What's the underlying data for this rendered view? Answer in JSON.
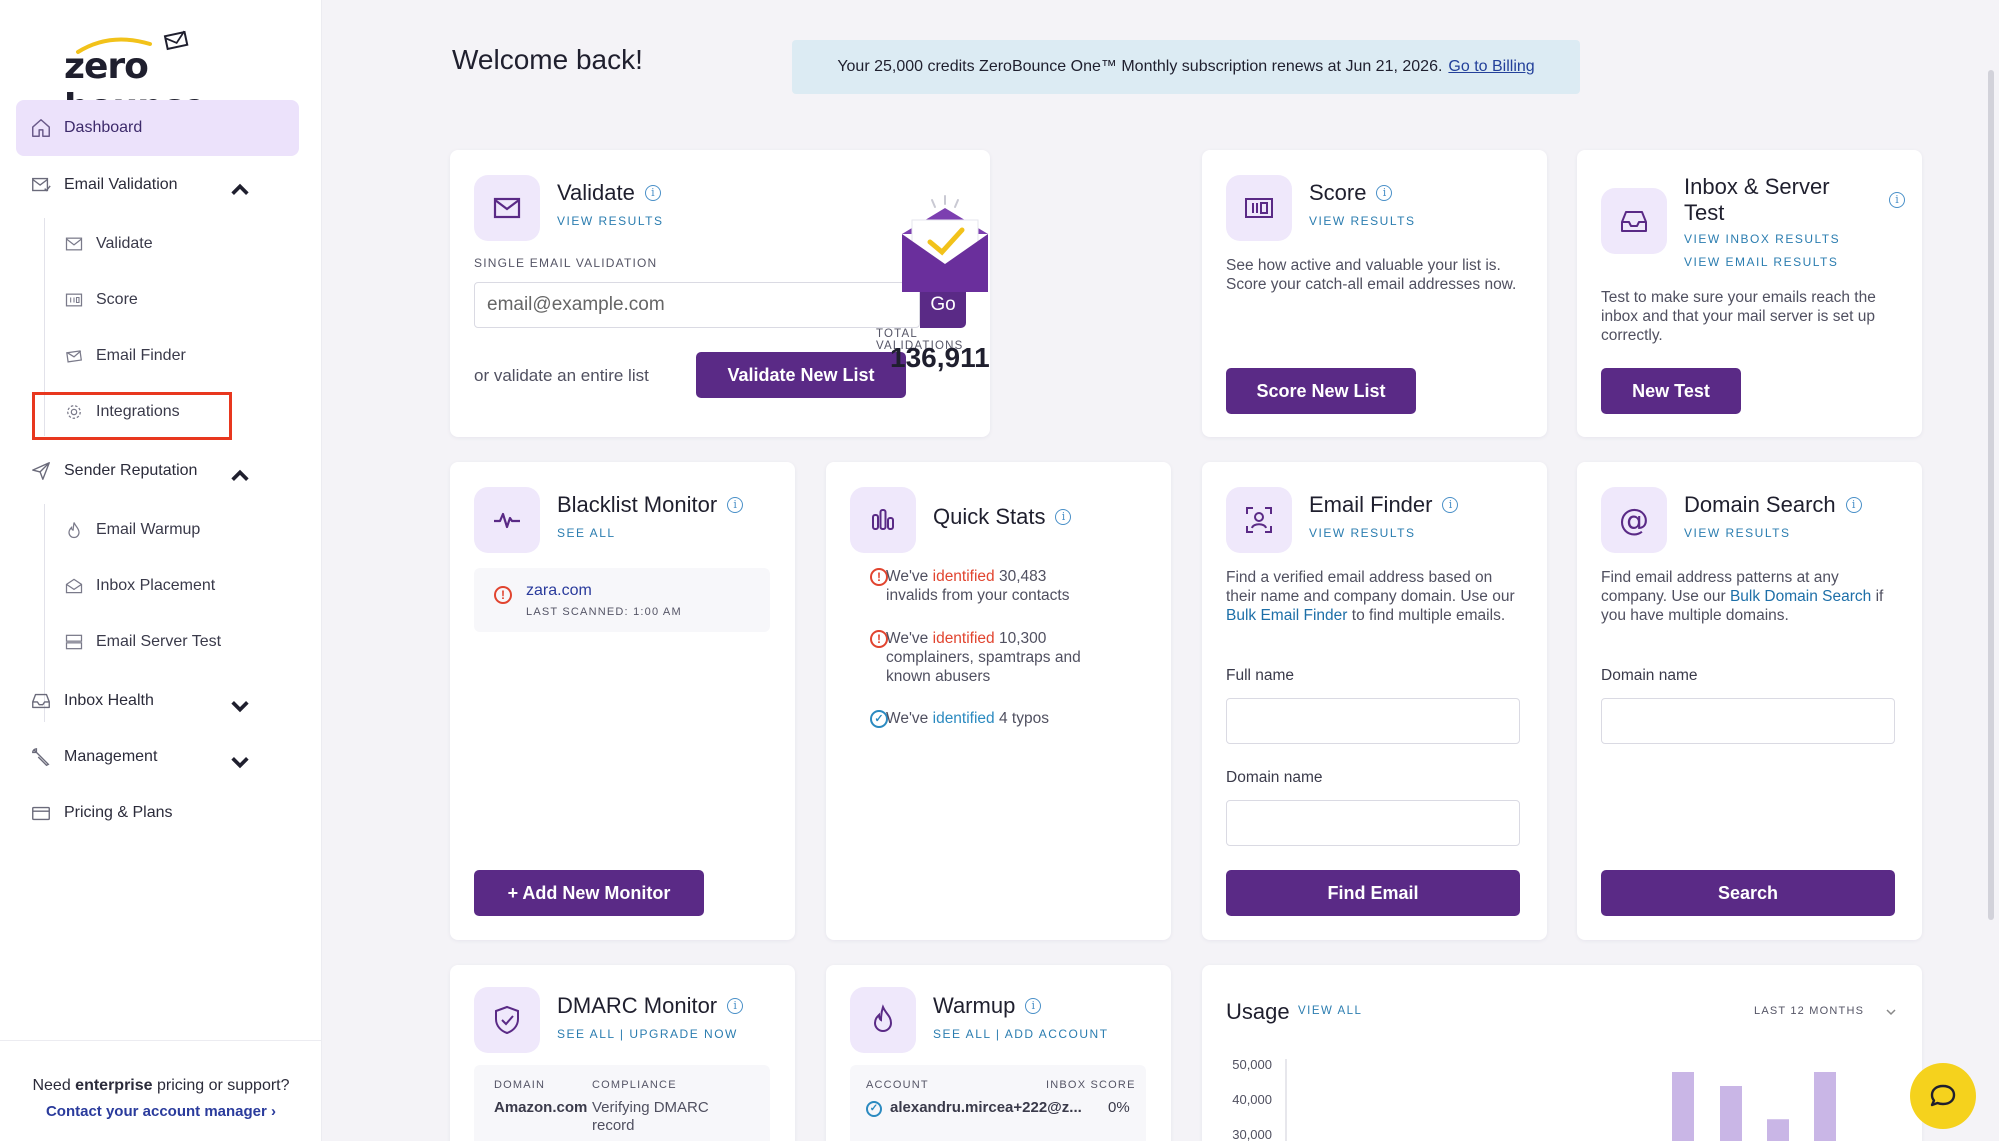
{
  "brand": {
    "name": "zero bounce"
  },
  "sidebar": {
    "dashboard": "Dashboard",
    "email_validation": "Email Validation",
    "validate": "Validate",
    "score": "Score",
    "email_finder": "Email Finder",
    "integrations": "Integrations",
    "sender_reputation": "Sender Reputation",
    "email_warmup": "Email Warmup",
    "inbox_placement": "Inbox Placement",
    "email_server_test": "Email Server Test",
    "inbox_health": "Inbox Health",
    "management": "Management",
    "pricing": "Pricing & Plans",
    "footer_prefix": "Need",
    "footer_bold": "enterprise",
    "footer_suffix": "pricing or support?",
    "footer_link": "Contact your account manager ›"
  },
  "header": {
    "welcome": "Welcome back!",
    "banner_text": "Your 25,000 credits ZeroBounce One™ Monthly subscription renews at Jun 21, 2026.",
    "banner_link": "Go to Billing"
  },
  "validate": {
    "title": "Validate",
    "link": "VIEW RESULTS",
    "label": "SINGLE EMAIL VALIDATION",
    "placeholder": "email@example.com",
    "go": "Go",
    "or_text": "or validate an entire list",
    "button": "Validate New List",
    "total_label": "TOTAL VALIDATIONS",
    "total_value": "136,911"
  },
  "score": {
    "title": "Score",
    "link": "VIEW RESULTS",
    "desc": "See how active and valuable your list is. Score your catch-all email addresses now.",
    "button": "Score New List"
  },
  "inbox": {
    "title_1": "Inbox & Server",
    "title_2": "Test",
    "link1": "VIEW INBOX RESULTS",
    "link2": "VIEW EMAIL RESULTS",
    "desc": "Test to make sure your emails reach the inbox and that your mail server is set up correctly.",
    "button": "New Test"
  },
  "blacklist": {
    "title": "Blacklist Monitor",
    "link": "SEE ALL",
    "domain": "zara.com",
    "scanned": "LAST SCANNED: 1:00 AM",
    "button": "+ Add New Monitor"
  },
  "quickstats": {
    "title": "Quick Stats",
    "s1_pre": "We've",
    "s1_hl": "identified",
    "s1_num": "30,483",
    "s1_rest": "invalids from your contacts",
    "s2_pre": "We've",
    "s2_hl": "identified",
    "s2_num": "10,300",
    "s2_rest1": "complainers, spamtraps and",
    "s2_rest2": "known abusers",
    "s3_pre": "We've",
    "s3_hl": "identified",
    "s3_rest": "4 typos"
  },
  "finder": {
    "title": "Email Finder",
    "link": "VIEW RESULTS",
    "desc_1": "Find a verified email address based on their name and company domain. Use our",
    "desc_link": "Bulk Email Finder",
    "desc_2": "to find multiple emails.",
    "full_name": "Full name",
    "domain_name": "Domain name",
    "button": "Find Email"
  },
  "domain": {
    "title": "Domain Search",
    "link": "VIEW RESULTS",
    "desc_1": "Find email address patterns at any company. Use our",
    "desc_link": "Bulk Domain Search",
    "desc_2": "if you have multiple domains.",
    "domain_name": "Domain name",
    "button": "Search"
  },
  "dmarc": {
    "title": "DMARC Monitor",
    "link": "SEE ALL | UPGRADE NOW",
    "col1": "DOMAIN",
    "col2": "COMPLIANCE",
    "domain": "Amazon.com",
    "compliance": "Verifying DMARC record"
  },
  "warmup": {
    "title": "Warmup",
    "link": "SEE ALL | ADD ACCOUNT",
    "col1": "ACCOUNT",
    "col2": "INBOX SCORE",
    "account": "alexandru.mircea+222@z...",
    "score": "0%"
  },
  "usage": {
    "title": "Usage",
    "link": "VIEW ALL",
    "range": "LAST 12 MONTHS"
  },
  "chart_data": {
    "type": "bar",
    "title": "Usage",
    "yticks": [
      50000,
      40000,
      30000
    ],
    "ytick_labels": [
      "50,000",
      "40,000",
      "30,000"
    ],
    "ylim": [
      30000,
      50000
    ],
    "values": [
      48000,
      44000,
      34500,
      48000
    ],
    "colors": [
      "#c9b6e6",
      "#c9b6e6",
      "#c9b6e6",
      "#c9b6e6"
    ],
    "grid": false
  },
  "colors": {
    "accent": "#5a2a86",
    "light_accent": "#efe8fb",
    "link": "#2b7db0",
    "alert": "#e1442f",
    "highlight_box": "#e8371e",
    "chat": "#f5d21d"
  }
}
